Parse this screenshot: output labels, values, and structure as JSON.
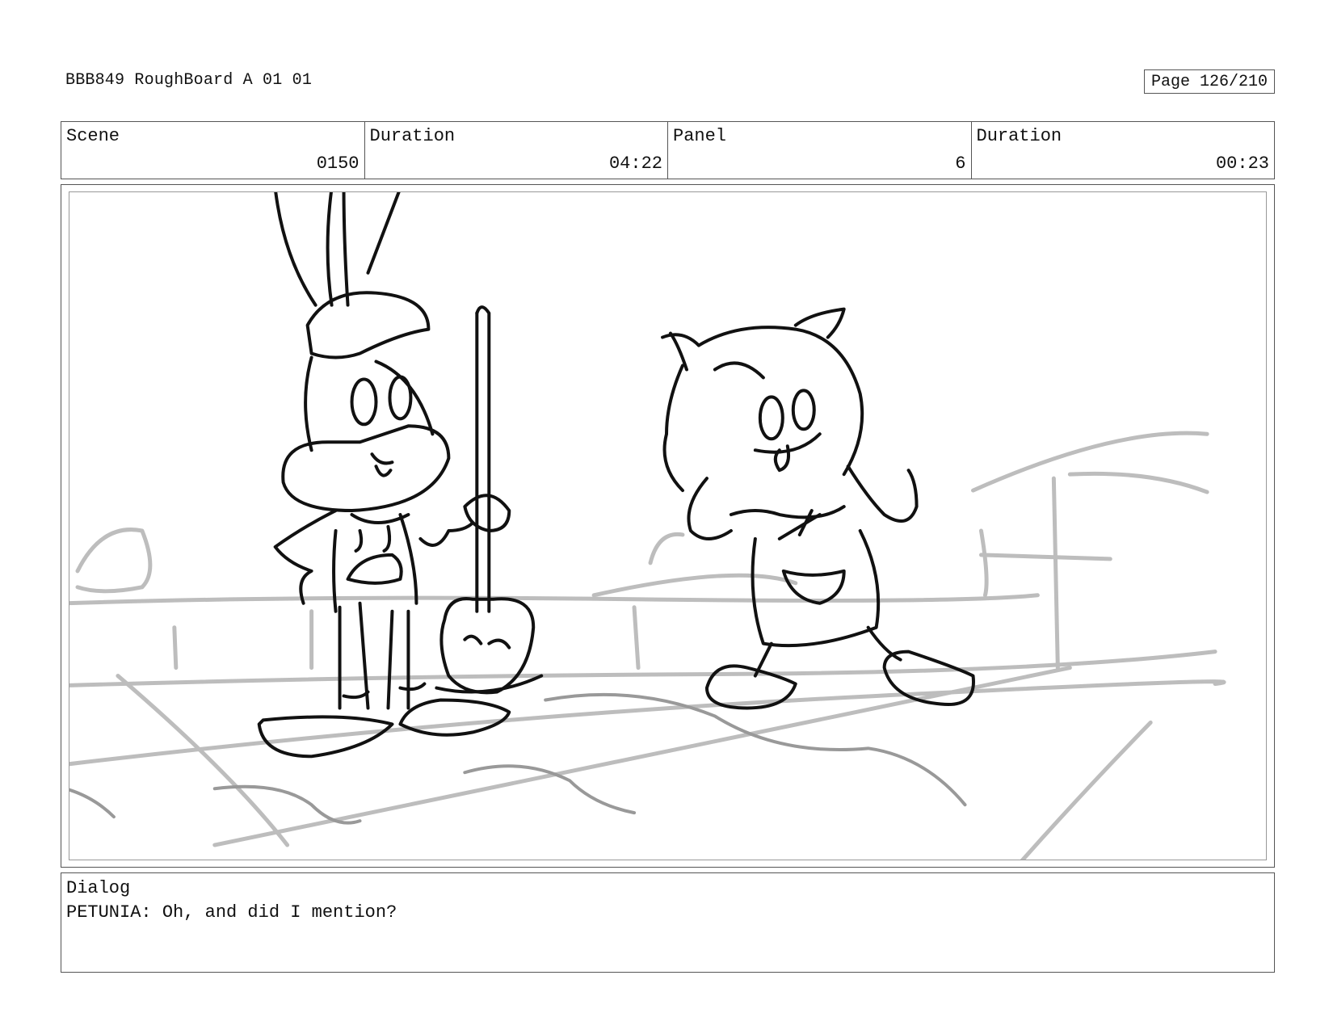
{
  "header": {
    "document_title": "BBB849 RoughBoard A 01 01",
    "page_label": "Page 126/210"
  },
  "info": {
    "scene_label": "Scene",
    "scene_value": "0150",
    "scene_duration_label": "Duration",
    "scene_duration_value": "04:22",
    "panel_label": "Panel",
    "panel_value": "6",
    "panel_duration_label": "Duration",
    "panel_duration_value": "00:23"
  },
  "dialog": {
    "label": "Dialog",
    "text": "PETUNIA: Oh, and did I mention?"
  },
  "colors": {
    "ink": "#111111",
    "background_sketch": "#bdbdbd",
    "border": "#555555"
  }
}
